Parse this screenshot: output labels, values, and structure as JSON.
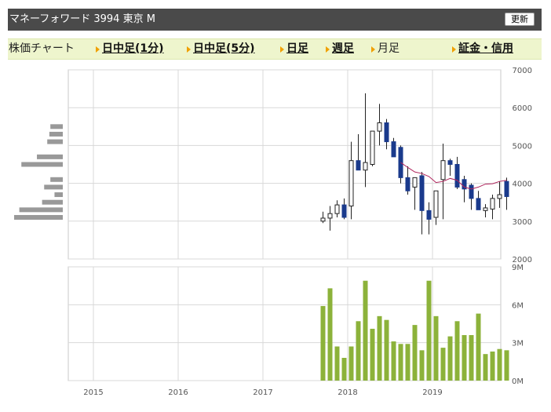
{
  "header": {
    "title": "マネーフォワード 3994 東京 M",
    "refresh_label": "更新"
  },
  "nav": {
    "label": "株価チャート",
    "links": [
      {
        "label": "日中足(1分)",
        "active": true
      },
      {
        "label": "日中足(5分)",
        "active": true
      },
      {
        "label": "日足",
        "active": true
      },
      {
        "label": "週足",
        "active": true
      },
      {
        "label": "月足",
        "active": false
      },
      {
        "label": "証金・信用",
        "active": true
      }
    ]
  },
  "colors": {
    "candle_down": "#1a3a8c",
    "candle_up": "#ffffff",
    "moving_average": "#b0245c",
    "volume_bar": "#8cb23a",
    "volume_profile": "#999999",
    "grid": "#d8d8d8"
  },
  "chart_data": {
    "type": "candlestick",
    "x_ticks": [
      "2015",
      "2016",
      "2017",
      "2018",
      "2019"
    ],
    "price_axis": {
      "ylim": [
        2000,
        7000
      ],
      "ticks": [
        "2000",
        "3000",
        "4000",
        "5000",
        "6000",
        "7000"
      ]
    },
    "volume_axis": {
      "ylim": [
        0,
        9
      ],
      "ticks": [
        "0M",
        "3M",
        "6M",
        "9M"
      ]
    },
    "months": [
      "2017-09",
      "2017-10",
      "2017-11",
      "2017-12",
      "2018-01",
      "2018-02",
      "2018-03",
      "2018-04",
      "2018-05",
      "2018-06",
      "2018-07",
      "2018-08",
      "2018-09",
      "2018-10",
      "2018-11",
      "2018-12",
      "2019-01",
      "2019-02",
      "2019-03",
      "2019-04",
      "2019-05",
      "2019-06",
      "2019-07",
      "2019-08",
      "2019-09",
      "2019-10",
      "2019-11"
    ],
    "open": [
      3000,
      3080,
      3200,
      3430,
      3400,
      4600,
      4350,
      4500,
      5380,
      5600,
      5100,
      4950,
      4150,
      3900,
      4200,
      3280,
      3100,
      4100,
      4600,
      4500,
      4100,
      3950,
      3600,
      3280,
      3320,
      3600,
      4050
    ],
    "high": [
      3250,
      3400,
      3550,
      3600,
      5100,
      5300,
      6380,
      5100,
      6100,
      5700,
      5200,
      5000,
      4450,
      4000,
      4300,
      3500,
      3800,
      5050,
      4650,
      4700,
      4200,
      4000,
      3800,
      3450,
      3700,
      4050,
      4150
    ],
    "low": [
      2950,
      2750,
      3100,
      3050,
      3050,
      4400,
      3900,
      4450,
      5000,
      4900,
      4700,
      4000,
      3700,
      3300,
      2650,
      2650,
      2900,
      3050,
      4200,
      3850,
      3500,
      3300,
      3400,
      3100,
      3050,
      3350,
      3300
    ],
    "close": [
      3080,
      3200,
      3430,
      3100,
      4600,
      4350,
      4550,
      5380,
      5600,
      5100,
      4700,
      4150,
      3800,
      4150,
      3280,
      3050,
      3800,
      4600,
      4500,
      3900,
      3850,
      3600,
      3300,
      3350,
      3600,
      3700,
      3650
    ],
    "moving_average": [
      null,
      null,
      null,
      null,
      null,
      null,
      null,
      null,
      null,
      null,
      null,
      4550,
      4420,
      4300,
      4260,
      4180,
      4020,
      4050,
      4130,
      4080,
      3900,
      3850,
      3900,
      3980,
      3990,
      4050,
      4080
    ],
    "volume": [
      5.9,
      7.3,
      2.7,
      1.8,
      2.7,
      4.7,
      7.9,
      4.1,
      5.1,
      4.8,
      3.1,
      2.9,
      2.9,
      4.4,
      2.4,
      7.9,
      5.1,
      2.6,
      3.5,
      4.7,
      3.6,
      3.6,
      5.3,
      2.1,
      2.3,
      2.5,
      2.4
    ],
    "volume_profile": [
      {
        "price": 5500,
        "volume": 1.2
      },
      {
        "price": 5300,
        "volume": 1.3
      },
      {
        "price": 5100,
        "volume": 1.5
      },
      {
        "price": 4700,
        "volume": 2.5
      },
      {
        "price": 4500,
        "volume": 4.0
      },
      {
        "price": 4100,
        "volume": 1.2
      },
      {
        "price": 3900,
        "volume": 1.8
      },
      {
        "price": 3700,
        "volume": 0.8
      },
      {
        "price": 3500,
        "volume": 2.0
      },
      {
        "price": 3300,
        "volume": 4.2
      },
      {
        "price": 3100,
        "volume": 4.7
      }
    ]
  }
}
